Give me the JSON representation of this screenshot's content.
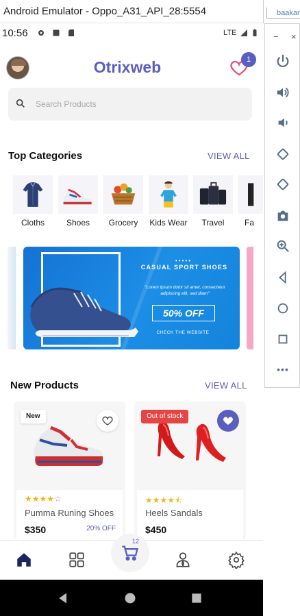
{
  "window": {
    "title": "Android Emulator - Oppo_A31_API_28:5554",
    "background_window_text": "baakar"
  },
  "side_panel": {
    "minimize": "−",
    "close": "×",
    "buttons": [
      "power-icon",
      "volume-up-icon",
      "volume-down-icon",
      "rotate-left-icon",
      "rotate-right-icon",
      "camera-icon",
      "zoom-icon",
      "back-icon",
      "home-icon",
      "overview-icon",
      "more-icon"
    ],
    "more": "•••"
  },
  "status_bar": {
    "time": "10:56",
    "network": "LTE"
  },
  "header": {
    "brand": "Otrixweb",
    "wishlist_count": "1"
  },
  "search": {
    "placeholder": "Search Products",
    "value": ""
  },
  "categories": {
    "title": "Top Categories",
    "view_all": "VIEW ALL",
    "items": [
      {
        "label": "Cloths",
        "icon": "shirt-icon"
      },
      {
        "label": "Shoes",
        "icon": "sneaker-icon"
      },
      {
        "label": "Grocery",
        "icon": "grocery-basket-icon"
      },
      {
        "label": "Kids Wear",
        "icon": "kid-icon"
      },
      {
        "label": "Travel",
        "icon": "luggage-icon"
      },
      {
        "label": "Fa",
        "icon": "fashion-icon"
      }
    ]
  },
  "banner": {
    "dots": "•••••",
    "title": "CASUAL SPORT SHOES",
    "text": "\"Lorem ipsum dolor sit amet, consectetur adipiscing elit, sed diam\"",
    "offer": "50% OFF",
    "link": "CHECK THE WEBSITE"
  },
  "new_products": {
    "title": "New Products",
    "view_all": "VIEW ALL",
    "items": [
      {
        "tag": "New",
        "name": "Pumma Runing Shoes",
        "price": "$350",
        "discount": "20% OFF",
        "rating": 4,
        "rating_max": 5,
        "favorite": false
      },
      {
        "tag": "Out of stock",
        "name": "Heels Sandals",
        "price": "$450",
        "discount": "",
        "rating": 4.5,
        "rating_max": 5,
        "favorite": true
      }
    ]
  },
  "bottom_nav": {
    "cart_count": "12",
    "items": [
      "home-icon",
      "grid-icon",
      "cart-icon",
      "profile-icon",
      "settings-icon"
    ]
  },
  "colors": {
    "accent": "#5a5ebf",
    "out_of_stock": "#e64545",
    "star": "#f0b619",
    "banner": "#1c8ee6"
  }
}
